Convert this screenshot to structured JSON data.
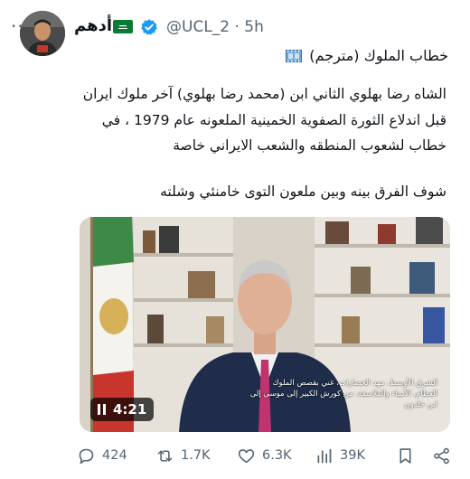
{
  "header": {
    "display_name": "أدهم",
    "handle_time": "@UCL_2 · 5h",
    "more_label": "···"
  },
  "tweet": {
    "title": "خطاب الملوك (مترجم)",
    "lines": [
      "الشاه رضا بهلوي الثاني ابن (محمد رضا بهلوي) آخر ملوك ايران",
      "قبل اندلاع الثورة الصفوية الخمينية الملعونه عام 1979 ، في",
      "خطاب لشعوب المنطقه والشعب الايراني خاصة",
      "شوف الفرق بينه وبين ملعون التوى خامنئي وشلته"
    ]
  },
  "video": {
    "duration": "4:21",
    "subtitle": "الشرق الأوسط، مهد الحضارات، غني بقصص الملوك العظام، الأنبياء والفلاسفة، من كورش الكبير إلى موسى إلى ابن خلدون"
  },
  "actions": {
    "replies": "424",
    "reposts": "1.7K",
    "likes": "6.3K",
    "views": "39K"
  },
  "colors": {
    "text": "#0f1419",
    "muted": "#536471",
    "verified": "#1d9bf0",
    "flag": "#0a7a34"
  }
}
